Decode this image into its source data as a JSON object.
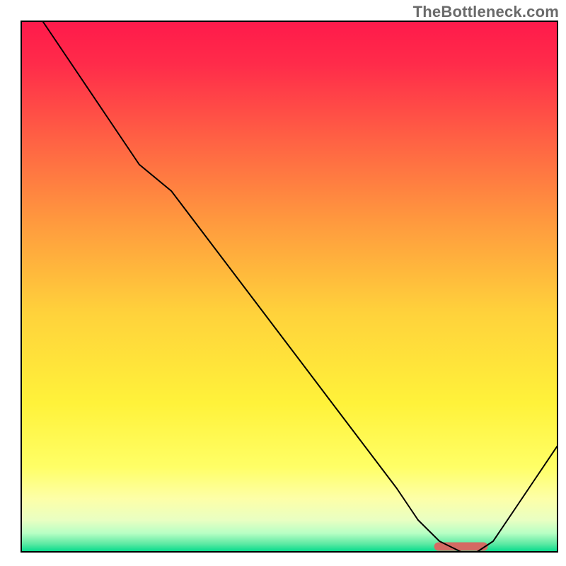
{
  "watermark": "TheBottleneck.com",
  "chart_data": {
    "type": "line",
    "title": "",
    "xlabel": "",
    "ylabel": "",
    "xlim": [
      0,
      100
    ],
    "ylim": [
      0,
      100
    ],
    "grid": false,
    "legend": false,
    "background_gradient": {
      "stops": [
        {
          "offset": 0.0,
          "color": "#ff1a4b"
        },
        {
          "offset": 0.08,
          "color": "#ff2b4a"
        },
        {
          "offset": 0.22,
          "color": "#ff6044"
        },
        {
          "offset": 0.38,
          "color": "#ff9a3e"
        },
        {
          "offset": 0.55,
          "color": "#ffd23b"
        },
        {
          "offset": 0.72,
          "color": "#fff23a"
        },
        {
          "offset": 0.84,
          "color": "#ffff66"
        },
        {
          "offset": 0.9,
          "color": "#fdffa8"
        },
        {
          "offset": 0.94,
          "color": "#e9ffc2"
        },
        {
          "offset": 0.965,
          "color": "#b7ffc4"
        },
        {
          "offset": 0.985,
          "color": "#5de9a3"
        },
        {
          "offset": 1.0,
          "color": "#00db8b"
        }
      ]
    },
    "series": [
      {
        "name": "bottleneck-curve",
        "color": "#000000",
        "stroke_width": 2,
        "x": [
          4,
          10,
          16,
          22,
          28,
          34,
          40,
          46,
          52,
          58,
          64,
          70,
          74,
          78,
          82,
          85,
          88,
          92,
          96,
          100
        ],
        "values": [
          100,
          91,
          82,
          73,
          68,
          60,
          52,
          44,
          36,
          28,
          20,
          12,
          6,
          2,
          0,
          0,
          2,
          8,
          14,
          20
        ]
      }
    ],
    "marker": {
      "name": "optimal-range-marker",
      "x_start": 77,
      "x_end": 87,
      "y": 1,
      "color": "#d46a63",
      "height": 1.6
    }
  }
}
